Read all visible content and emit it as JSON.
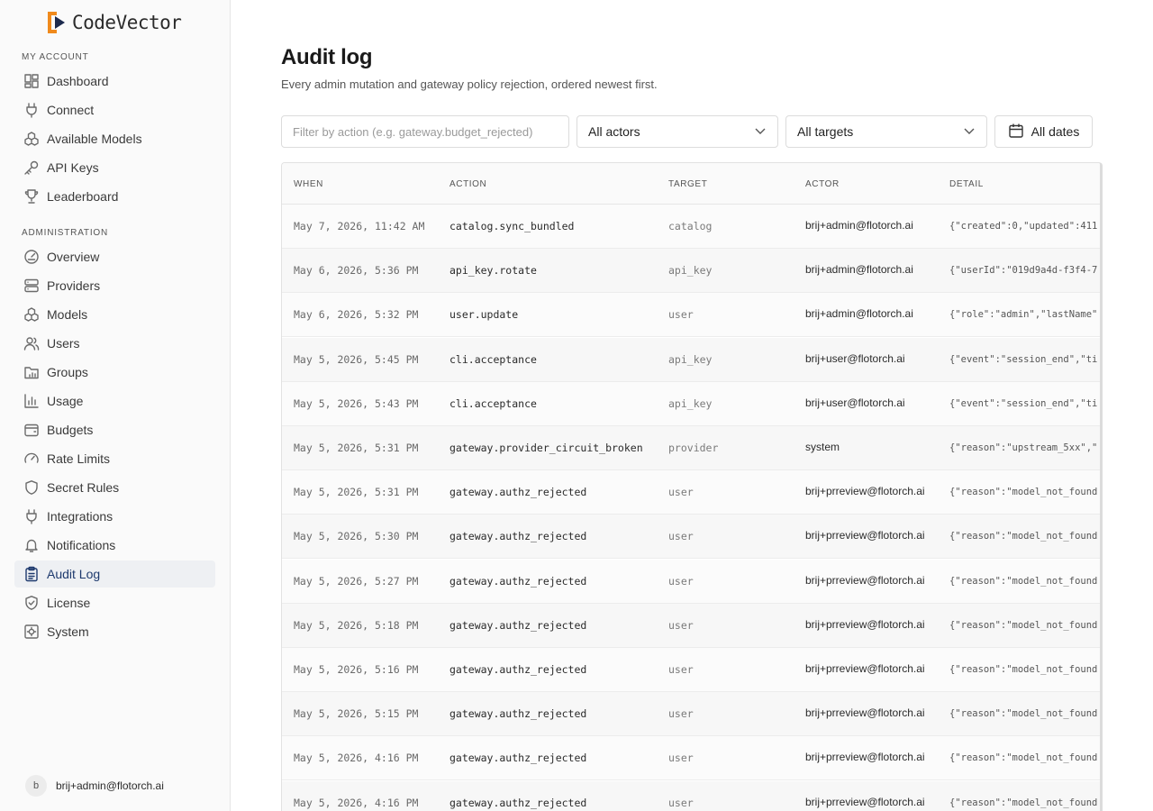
{
  "brand": {
    "name": "CodeVector"
  },
  "sidebar": {
    "my_account_label": "MY ACCOUNT",
    "my_account": [
      {
        "label": "Dashboard",
        "icon": "dashboard-icon"
      },
      {
        "label": "Connect",
        "icon": "plug-icon"
      },
      {
        "label": "Available Models",
        "icon": "models-icon"
      },
      {
        "label": "API Keys",
        "icon": "key-icon"
      },
      {
        "label": "Leaderboard",
        "icon": "trophy-icon"
      }
    ],
    "admin_label": "ADMINISTRATION",
    "admin": [
      {
        "label": "Overview",
        "icon": "gauge-icon"
      },
      {
        "label": "Providers",
        "icon": "server-icon"
      },
      {
        "label": "Models",
        "icon": "models-icon"
      },
      {
        "label": "Users",
        "icon": "users-icon"
      },
      {
        "label": "Groups",
        "icon": "groups-icon"
      },
      {
        "label": "Usage",
        "icon": "bar-chart-icon"
      },
      {
        "label": "Budgets",
        "icon": "wallet-icon"
      },
      {
        "label": "Rate Limits",
        "icon": "speedometer-icon"
      },
      {
        "label": "Secret Rules",
        "icon": "shield-icon"
      },
      {
        "label": "Integrations",
        "icon": "plug-icon"
      },
      {
        "label": "Notifications",
        "icon": "bell-icon"
      },
      {
        "label": "Audit Log",
        "icon": "clipboard-icon",
        "active": true
      },
      {
        "label": "License",
        "icon": "shield-check-icon"
      },
      {
        "label": "System",
        "icon": "system-icon"
      }
    ],
    "user": {
      "initial": "b",
      "email": "brij+admin@flotorch.ai"
    }
  },
  "main": {
    "title": "Audit log",
    "subtitle": "Every admin mutation and gateway policy rejection, ordered newest first.",
    "filters": {
      "action_placeholder": "Filter by action (e.g. gateway.budget_rejected)",
      "actors_value": "All actors",
      "targets_value": "All targets",
      "dates_label": "All dates"
    },
    "table": {
      "columns": [
        "WHEN",
        "ACTION",
        "TARGET",
        "ACTOR",
        "DETAIL"
      ],
      "rows": [
        {
          "when": "May 7, 2026, 11:42 AM",
          "action": "catalog.sync_bundled",
          "target": "catalog",
          "actor": "brij+admin@flotorch.ai",
          "detail": "{\"created\":0,\"updated\":411"
        },
        {
          "when": "May 6, 2026, 5:36 PM",
          "action": "api_key.rotate",
          "target": "api_key",
          "actor": "brij+admin@flotorch.ai",
          "detail": "{\"userId\":\"019d9a4d-f3f4-7"
        },
        {
          "when": "May 6, 2026, 5:32 PM",
          "action": "user.update",
          "target": "user",
          "actor": "brij+admin@flotorch.ai",
          "detail": "{\"role\":\"admin\",\"lastName\""
        },
        {
          "when": "May 5, 2026, 5:45 PM",
          "action": "cli.acceptance",
          "target": "api_key",
          "actor": "brij+user@flotorch.ai",
          "detail": "{\"event\":\"session_end\",\"ti"
        },
        {
          "when": "May 5, 2026, 5:43 PM",
          "action": "cli.acceptance",
          "target": "api_key",
          "actor": "brij+user@flotorch.ai",
          "detail": "{\"event\":\"session_end\",\"ti"
        },
        {
          "when": "May 5, 2026, 5:31 PM",
          "action": "gateway.provider_circuit_broken",
          "target": "provider",
          "actor": "system",
          "detail": "{\"reason\":\"upstream_5xx\",\""
        },
        {
          "when": "May 5, 2026, 5:31 PM",
          "action": "gateway.authz_rejected",
          "target": "user",
          "actor": "brij+prreview@flotorch.ai",
          "detail": "{\"reason\":\"model_not_found"
        },
        {
          "when": "May 5, 2026, 5:30 PM",
          "action": "gateway.authz_rejected",
          "target": "user",
          "actor": "brij+prreview@flotorch.ai",
          "detail": "{\"reason\":\"model_not_found"
        },
        {
          "when": "May 5, 2026, 5:27 PM",
          "action": "gateway.authz_rejected",
          "target": "user",
          "actor": "brij+prreview@flotorch.ai",
          "detail": "{\"reason\":\"model_not_found"
        },
        {
          "when": "May 5, 2026, 5:18 PM",
          "action": "gateway.authz_rejected",
          "target": "user",
          "actor": "brij+prreview@flotorch.ai",
          "detail": "{\"reason\":\"model_not_found"
        },
        {
          "when": "May 5, 2026, 5:16 PM",
          "action": "gateway.authz_rejected",
          "target": "user",
          "actor": "brij+prreview@flotorch.ai",
          "detail": "{\"reason\":\"model_not_found"
        },
        {
          "when": "May 5, 2026, 5:15 PM",
          "action": "gateway.authz_rejected",
          "target": "user",
          "actor": "brij+prreview@flotorch.ai",
          "detail": "{\"reason\":\"model_not_found"
        },
        {
          "when": "May 5, 2026, 4:16 PM",
          "action": "gateway.authz_rejected",
          "target": "user",
          "actor": "brij+prreview@flotorch.ai",
          "detail": "{\"reason\":\"model_not_found"
        },
        {
          "when": "May 5, 2026, 4:16 PM",
          "action": "gateway.authz_rejected",
          "target": "user",
          "actor": "brij+prreview@flotorch.ai",
          "detail": "{\"reason\":\"model_not_found"
        }
      ]
    }
  },
  "colors": {
    "accent": "#1e3a6e",
    "brand_orange": "#f08a1c",
    "brand_navy": "#1c2a4d",
    "active_bg": "#eef0f3"
  }
}
